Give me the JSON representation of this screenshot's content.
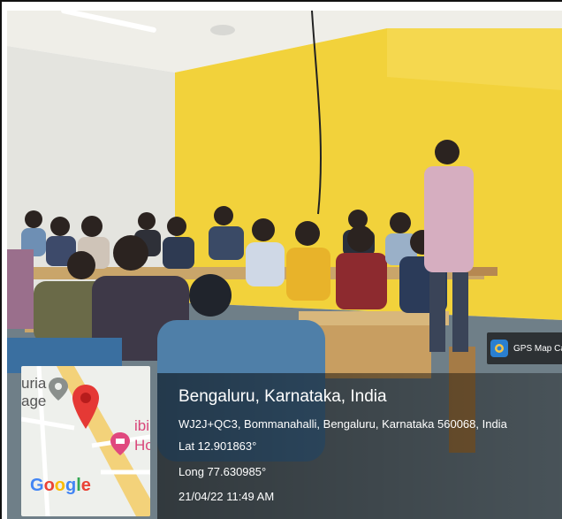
{
  "gps_badge": {
    "label": "GPS Map Ca",
    "icon": "gps-map-camera-icon"
  },
  "location": {
    "title": "Bengaluru, Karnataka, India",
    "address": "WJ2J+QC3, Bommanahalli, Bengaluru, Karnataka 560068, India",
    "latitude": "Lat 12.901863°",
    "longitude": "Long 77.630985°",
    "datetime": "21/04/22 11:49 AM"
  },
  "map": {
    "label_left_top": "uria",
    "label_left_bottom": "age",
    "label_right_top": "ibi",
    "label_right_bottom": "Ho",
    "pin_icon": "location-pin-icon",
    "hotel_icon": "hotel-pin-icon",
    "logo": [
      "G",
      "o",
      "o",
      "g",
      "l",
      "e"
    ],
    "colors": {
      "pin": "#e53935",
      "road": "#f3d27a",
      "water": "#aac8e8"
    }
  }
}
